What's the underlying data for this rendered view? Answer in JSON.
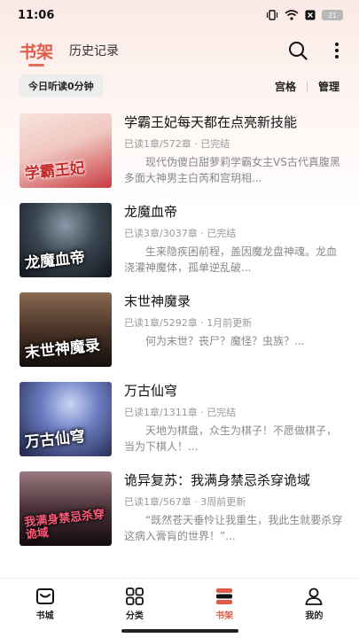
{
  "status": {
    "time": "11:06",
    "battery": "21"
  },
  "header": {
    "tab_active": "书架",
    "tab_other": "历史记录"
  },
  "listen": {
    "label": "今日听读0分钟"
  },
  "view": {
    "grid_label": "宫格",
    "manage_label": "管理"
  },
  "books": [
    {
      "title": "学霸王妃每天都在点亮新技能",
      "meta": "已读1章/572章 · 已完结",
      "desc": "现代伪傻白甜萝莉学霸女主VS古代真腹黑多面大神男主白芮和宫玥相...",
      "cover_text": "学霸王妃",
      "cover_colors": [
        "#f5d7cc",
        "#d9434a"
      ]
    },
    {
      "title": "龙魔血帝",
      "meta": "已读3章/3037章 · 已完结",
      "desc": "生来隐疾困前程，盖因魔龙盘神魂。龙血浇灌神魔体，孤单逆乱破...",
      "cover_text": "龙魔血帝",
      "cover_colors": [
        "#5a6b7a",
        "#1b2028"
      ]
    },
    {
      "title": "末世神魔录",
      "meta": "已读1章/5292章 · 1月前更新",
      "desc": "何为末世？丧尸？魔怪？虫族？...",
      "cover_text": "末世神魔录",
      "cover_colors": [
        "#6b4a3a",
        "#1e1613"
      ]
    },
    {
      "title": "万古仙穹",
      "meta": "已读1章/1311章 · 已完结",
      "desc": "天地为棋盘，众生为棋子！不愿做棋子，当为下棋人！...",
      "cover_text": "万古仙穹",
      "cover_colors": [
        "#8fa2d8",
        "#2a2f5a"
      ]
    },
    {
      "title": "诡异复苏：我满身禁忌杀穿诡域",
      "meta": "已读1章/567章 · 3周前更新",
      "desc": "“既然苍天垂怜让我重生，我此生就要杀穿这病入膏肓的世界！”...",
      "cover_text": "我满身禁忌杀穿诡域",
      "cover_colors": [
        "#7a5a60",
        "#1b1418"
      ]
    }
  ],
  "nav": [
    {
      "label": "书城",
      "icon": "bookstore-icon"
    },
    {
      "label": "分类",
      "icon": "category-icon"
    },
    {
      "label": "书架",
      "icon": "bookshelf-icon",
      "active": true
    },
    {
      "label": "我的",
      "icon": "profile-icon"
    }
  ],
  "colors": {
    "accent": "#e05a48"
  }
}
